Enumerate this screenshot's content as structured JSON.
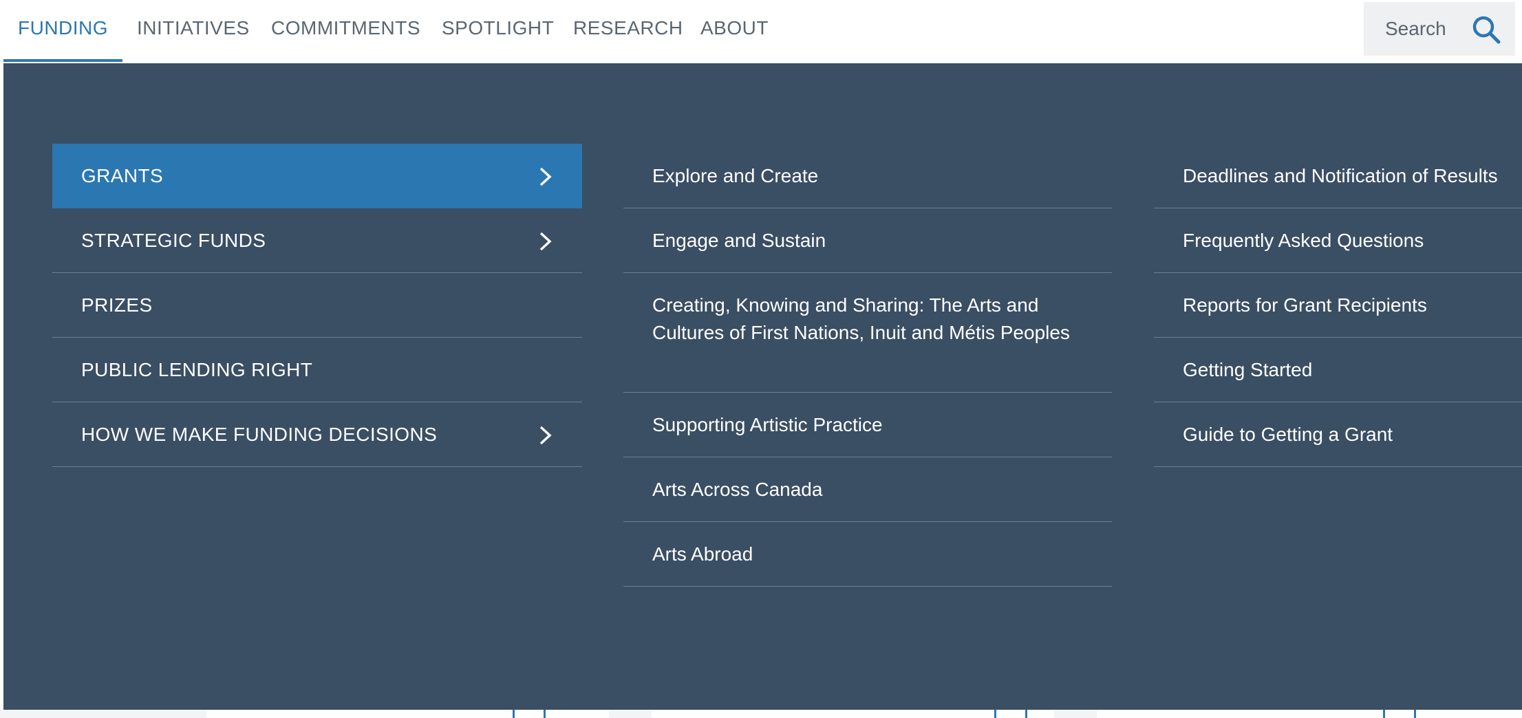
{
  "nav": {
    "items": [
      {
        "label": "FUNDING",
        "active": true
      },
      {
        "label": "INITIATIVES"
      },
      {
        "label": "COMMITMENTS"
      },
      {
        "label": "SPOTLIGHT"
      },
      {
        "label": "RESEARCH"
      },
      {
        "label": "ABOUT"
      }
    ],
    "search": {
      "placeholder": "Search",
      "icon": "search-icon"
    }
  },
  "colors": {
    "accent": "#2b77b2",
    "panel_background": "#3a4e64",
    "nav_text": "#5b6670"
  },
  "menu": {
    "primary": [
      {
        "label": "GRANTS",
        "selected": true,
        "has_submenu": true
      },
      {
        "label": "STRATEGIC FUNDS",
        "has_submenu": true
      },
      {
        "label": "PRIZES"
      },
      {
        "label": "PUBLIC LENDING RIGHT"
      },
      {
        "label": "HOW WE MAKE FUNDING DECISIONS",
        "has_submenu": true
      }
    ],
    "grant_programs": [
      {
        "label": "Explore and Create"
      },
      {
        "label": "Engage and Sustain"
      },
      {
        "label": "Creating, Knowing and Sharing: The Arts and Cultures of First Nations, Inuit and Métis Peoples"
      },
      {
        "label": "Supporting Artistic Practice"
      },
      {
        "label": "Arts Across Canada"
      },
      {
        "label": "Arts Abroad"
      }
    ],
    "grant_resources": [
      {
        "label": "Deadlines and Notification of Results"
      },
      {
        "label": "Frequently Asked Questions"
      },
      {
        "label": "Reports for Grant Recipients"
      },
      {
        "label": "Getting Started"
      },
      {
        "label": "Guide to Getting a Grant"
      }
    ]
  }
}
